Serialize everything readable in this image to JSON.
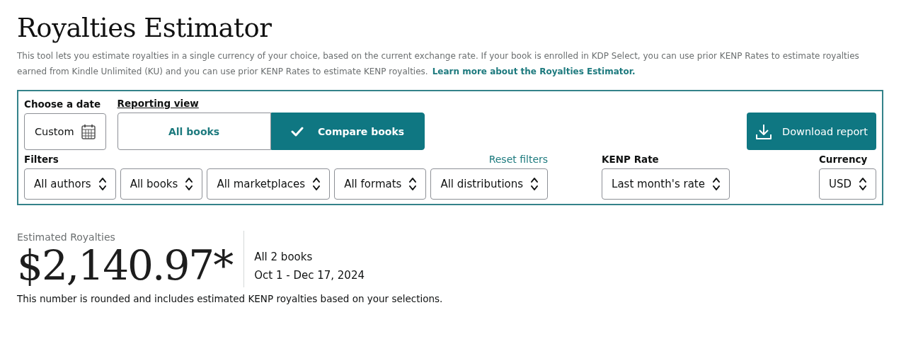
{
  "title": "Royalties Estimator",
  "description": {
    "text": "This tool lets you estimate royalties in a single currency of your choice, based on the current exchange rate. If your book is enrolled in KDP Select, you can use prior KENP Rates to estimate royalties earned from Kindle Unlimited (KU) and you can use prior KENP Rates to estimate KENP royalties.",
    "link": "Learn more about the Royalties Estimator."
  },
  "date": {
    "label": "Choose a date",
    "value": "Custom"
  },
  "reporting_view": {
    "label": "Reporting view",
    "options": [
      {
        "label": "All books",
        "selected": false
      },
      {
        "label": "Compare books",
        "selected": true
      }
    ]
  },
  "download_button": "Download report",
  "filters": {
    "label": "Filters",
    "reset": "Reset filters",
    "selects": [
      "All authors",
      "All books",
      "All marketplaces",
      "All formats",
      "All distributions"
    ]
  },
  "kenp_rate": {
    "label": "KENP Rate",
    "value": "Last month's rate"
  },
  "currency": {
    "label": "Currency",
    "value": "USD"
  },
  "summary": {
    "label": "Estimated Royalties",
    "amount": "$2,140.97*",
    "books": "All 2 books",
    "range": "Oct 1 - Dec 17, 2024",
    "note": "This number is rounded and includes estimated KENP royalties based on your selections."
  }
}
